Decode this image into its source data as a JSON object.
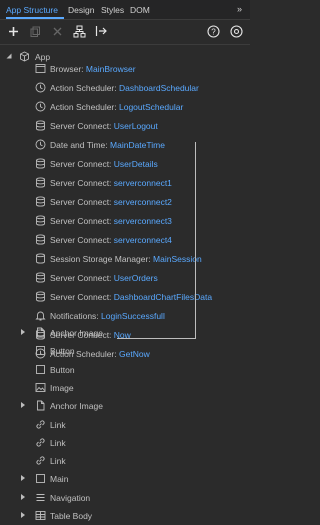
{
  "tabs": [
    {
      "label": "App Structure",
      "active": true
    },
    {
      "label": "Design",
      "active": false
    },
    {
      "label": "Styles",
      "active": false
    },
    {
      "label": "DOM",
      "active": false
    }
  ],
  "more_icon": "chevron-double-right-icon",
  "toolbar": {
    "left": [
      "add-icon",
      "copy-icon",
      "delete-icon",
      "structure-icon",
      "export-icon"
    ],
    "right": [
      "help-icon",
      "settings-icon"
    ]
  },
  "app_label": "App",
  "children": [
    {
      "icon": "browser-icon",
      "type": "Browser:",
      "name": "MainBrowser"
    },
    {
      "icon": "clock-icon",
      "type": "Action Scheduler:",
      "name": "DashboardSchedular"
    },
    {
      "icon": "clock-icon",
      "type": "Action Scheduler:",
      "name": "LogoutSchedular"
    },
    {
      "icon": "database-icon",
      "type": "Server Connect:",
      "name": "UserLogout"
    },
    {
      "icon": "clock-icon",
      "type": "Date and Time:",
      "name": "MainDateTime"
    },
    {
      "icon": "database-icon",
      "type": "Server Connect:",
      "name": "UserDetails"
    },
    {
      "icon": "database-icon",
      "type": "Server Connect:",
      "name": "serverconnect1"
    },
    {
      "icon": "database-icon",
      "type": "Server Connect:",
      "name": "serverconnect2"
    },
    {
      "icon": "database-icon",
      "type": "Server Connect:",
      "name": "serverconnect3"
    },
    {
      "icon": "database-icon",
      "type": "Server Connect:",
      "name": "serverconnect4"
    },
    {
      "icon": "storage-icon",
      "type": "Session Storage Manager:",
      "name": "MainSession"
    },
    {
      "icon": "database-icon",
      "type": "Server Connect:",
      "name": "UserOrders"
    },
    {
      "icon": "database-icon",
      "type": "Server Connect:",
      "name": "DashboardChartFilesData"
    },
    {
      "icon": "bell-icon",
      "type": "Notifications:",
      "name": "LoginSuccessfull"
    },
    {
      "icon": "database-icon",
      "type": "Server Connect:",
      "name": "Now"
    },
    {
      "icon": "clock-icon",
      "type": "Action Scheduler:",
      "name": "GetNow"
    }
  ],
  "elements": [
    {
      "icon": "file-icon",
      "label": "Anchor Image",
      "expandable": true
    },
    {
      "icon": "square-icon",
      "label": "Button",
      "expandable": false
    },
    {
      "icon": "square-icon",
      "label": "Button",
      "expandable": false
    },
    {
      "icon": "image-icon",
      "label": "Image",
      "expandable": false
    },
    {
      "icon": "file-icon",
      "label": "Anchor Image",
      "expandable": true
    },
    {
      "icon": "link-icon",
      "label": "Link",
      "expandable": false
    },
    {
      "icon": "link-icon",
      "label": "Link",
      "expandable": false
    },
    {
      "icon": "link-icon",
      "label": "Link",
      "expandable": false
    },
    {
      "icon": "square-icon",
      "label": "Main",
      "expandable": true
    },
    {
      "icon": "list-icon",
      "label": "Navigation",
      "expandable": true
    },
    {
      "icon": "table-icon",
      "label": "Table Body",
      "expandable": true
    }
  ],
  "colors": {
    "accent": "#5aa9ff",
    "background": "#2b2b2b",
    "text": "#c0c0c0"
  }
}
